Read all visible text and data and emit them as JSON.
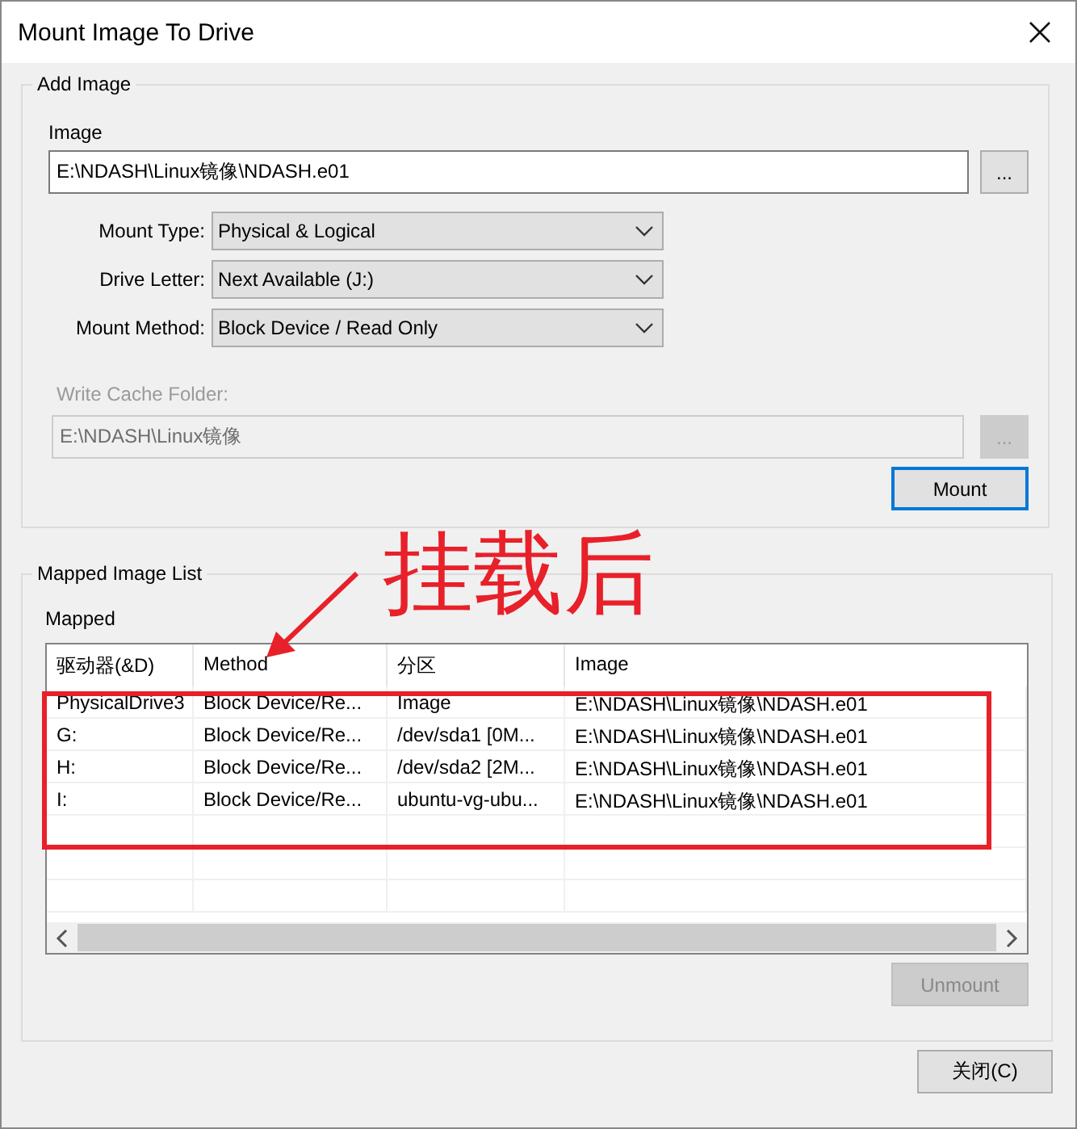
{
  "window": {
    "title": "Mount Image To Drive"
  },
  "add_image": {
    "title": "Add Image",
    "image_label": "Image",
    "image_value": "E:\\NDASH\\Linux镜像\\NDASH.e01",
    "browse": "...",
    "options": [
      {
        "label": "Mount Type:",
        "value": "Physical & Logical"
      },
      {
        "label": "Drive Letter:",
        "value": "Next Available (J:)"
      },
      {
        "label": "Mount Method:",
        "value": "Block Device / Read Only"
      }
    ],
    "cache_label": "Write Cache Folder:",
    "cache_value": "E:\\NDASH\\Linux镜像",
    "cache_browse": "...",
    "cache_disabled": true,
    "mount_button": "Mount"
  },
  "mapped": {
    "title": "Mapped Image List",
    "subtitle": "Mapped",
    "columns": [
      "驱动器(&D)",
      "Method",
      "分区",
      "Image"
    ],
    "rows": [
      [
        "PhysicalDrive3",
        "Block Device/Re...",
        "Image",
        "E:\\NDASH\\Linux镜像\\NDASH.e01"
      ],
      [
        "G:",
        "Block Device/Re...",
        "/dev/sda1 [0M...",
        "E:\\NDASH\\Linux镜像\\NDASH.e01"
      ],
      [
        "H:",
        "Block Device/Re...",
        "/dev/sda2 [2M...",
        "E:\\NDASH\\Linux镜像\\NDASH.e01"
      ],
      [
        "I:",
        "Block Device/Re...",
        "ubuntu-vg-ubu...",
        "E:\\NDASH\\Linux镜像\\NDASH.e01"
      ]
    ],
    "unmount_button": "Unmount",
    "unmount_disabled": true
  },
  "close_button": "关闭(C)",
  "annotation": {
    "text": "挂载后"
  }
}
